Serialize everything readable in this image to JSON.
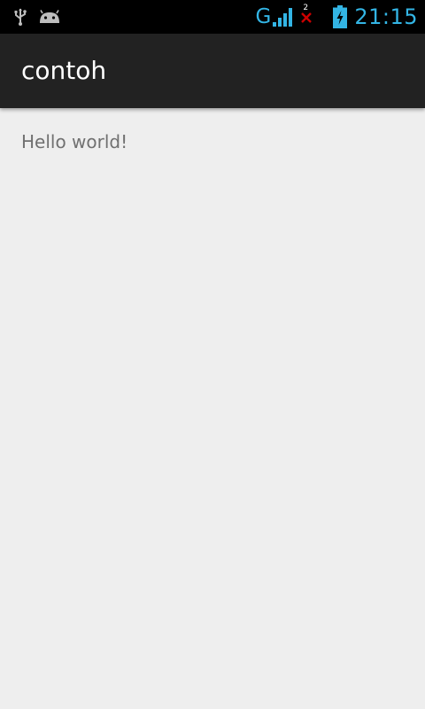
{
  "status_bar": {
    "notifications": [
      "usb-icon",
      "android-debug-icon"
    ],
    "network_type": "G",
    "sim2_label": "2",
    "clock": "21:15",
    "colors": {
      "accent": "#33b5e5",
      "alert": "#cc0000"
    }
  },
  "action_bar": {
    "title": "contoh"
  },
  "content": {
    "text": "Hello world!"
  }
}
